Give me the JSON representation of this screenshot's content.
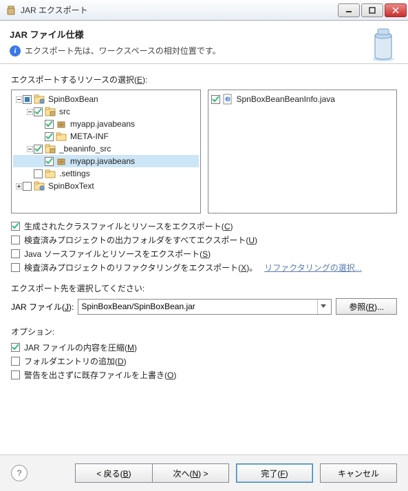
{
  "window": {
    "title": "JAR エクスポート"
  },
  "header": {
    "title": "JAR ファイル仕様",
    "desc": "エクスポート先は、ワークスペースの相対位置です。"
  },
  "resources": {
    "label_pre": "エクスポートするリソースの選択(",
    "label_key": "E",
    "label_post": "):"
  },
  "tree_left": [
    {
      "level": 0,
      "expand": "minus",
      "check": "partial",
      "icon": "project",
      "label": "SpinBoxBean"
    },
    {
      "level": 1,
      "expand": "minus",
      "check": "on",
      "icon": "srcfolder",
      "label": "src"
    },
    {
      "level": 2,
      "expand": "none",
      "check": "on",
      "icon": "package",
      "label": "myapp.javabeans"
    },
    {
      "level": 2,
      "expand": "none",
      "check": "on",
      "icon": "folder",
      "label": "META-INF"
    },
    {
      "level": 1,
      "expand": "minus",
      "check": "on",
      "icon": "srcfolder",
      "label": "_beaninfo_src"
    },
    {
      "level": 2,
      "expand": "none",
      "check": "on",
      "icon": "package",
      "label": "myapp.javabeans",
      "selected": true
    },
    {
      "level": 1,
      "expand": "none",
      "check": "off",
      "icon": "folder",
      "label": ".settings"
    },
    {
      "level": 0,
      "expand": "plus",
      "check": "off",
      "icon": "project",
      "label": "SpinBoxText"
    }
  ],
  "tree_right": [
    {
      "check": "on",
      "icon": "java",
      "label": "SpnBoxBeanBeanInfo.java"
    }
  ],
  "options1": [
    {
      "checked": true,
      "text": "生成されたクラスファイルとリソースをエクスポート(",
      "key": "C",
      "post": ")"
    },
    {
      "checked": false,
      "text": "検査済みプロジェクトの出力フォルダをすべてエクスポート(",
      "key": "U",
      "post": ")"
    },
    {
      "checked": false,
      "text": "Java ソースファイルとリソースをエクスポート(",
      "key": "S",
      "post": ")"
    },
    {
      "checked": false,
      "text": "検査済みプロジェクトのリファクタリングをエクスポート(",
      "key": "X",
      "post": ")。",
      "link": "リファクタリングの選択..."
    }
  ],
  "dest": {
    "label": "エクスポート先を選択してください:",
    "file_label_pre": "JAR ファイル(",
    "file_label_key": "J",
    "file_label_post": "):",
    "value": "SpinBoxBean/SpinBoxBean.jar",
    "browse_pre": "参照(",
    "browse_key": "R",
    "browse_post": ")..."
  },
  "options2_label": "オプション:",
  "options2": [
    {
      "checked": true,
      "text": "JAR ファイルの内容を圧縮(",
      "key": "M",
      "post": ")"
    },
    {
      "checked": false,
      "text": "フォルダエントリの追加(",
      "key": "D",
      "post": ")"
    },
    {
      "checked": false,
      "text": "警告を出さずに既存ファイルを上書き(",
      "key": "O",
      "post": ")"
    }
  ],
  "footer": {
    "back_pre": "< 戻る(",
    "back_key": "B",
    "back_post": ")",
    "next_pre": "次へ(",
    "next_key": "N",
    "next_post": ") >",
    "finish_pre": "完了(",
    "finish_key": "F",
    "finish_post": ")",
    "cancel": "キャンセル"
  }
}
